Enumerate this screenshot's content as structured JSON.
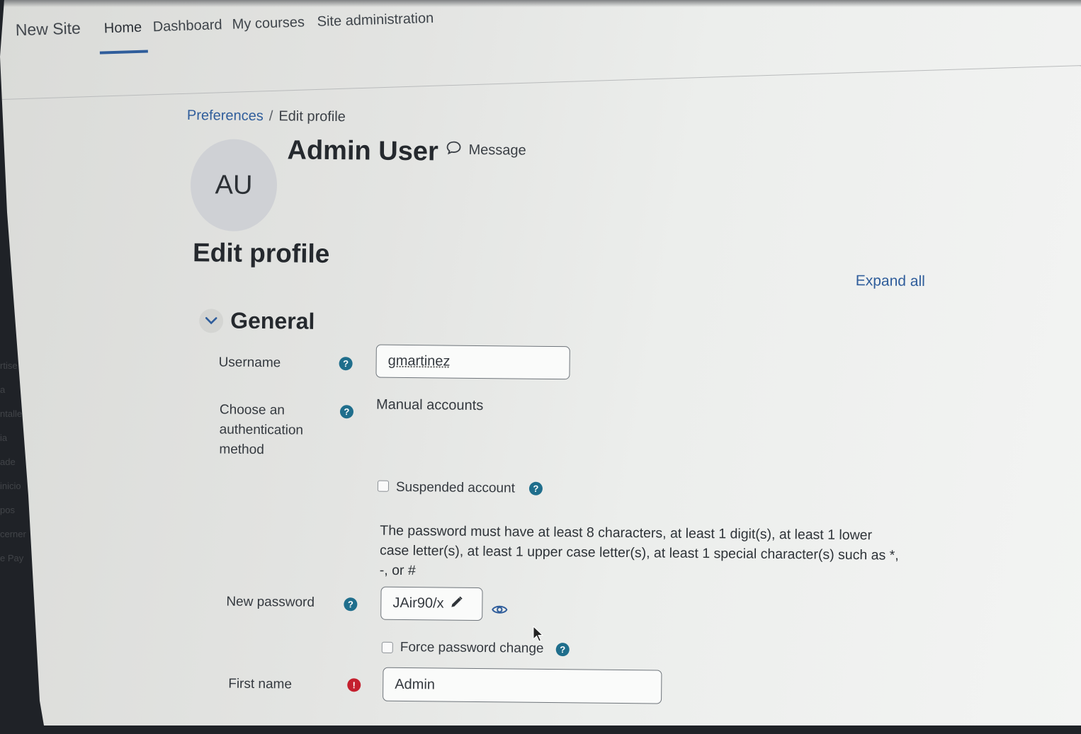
{
  "header": {
    "site_name": "New Site",
    "nav": [
      {
        "label": "Home",
        "active": true
      },
      {
        "label": "Dashboard",
        "active": false
      },
      {
        "label": "My courses",
        "active": false
      },
      {
        "label": "Site administration",
        "active": false
      }
    ]
  },
  "breadcrumb": {
    "parent": "Preferences",
    "separator": "/",
    "current": "Edit profile"
  },
  "profile": {
    "initials": "AU",
    "name": "Admin User",
    "message_label": "Message"
  },
  "page": {
    "title": "Edit profile",
    "expand_all": "Expand all"
  },
  "general": {
    "title": "General",
    "username_label": "Username",
    "username_value": "gmartinez",
    "auth_label_lines": [
      "Choose an",
      "authentication",
      "method"
    ],
    "auth_value": "Manual accounts",
    "suspended_label": "Suspended account",
    "suspended_checked": false,
    "password_rule_lines": [
      "The password must have at least 8 characters, at least 1 digit(s), at least 1 lower",
      "case letter(s), at least 1 upper case letter(s), at least 1 special character(s) such as *,",
      "-, or #"
    ],
    "new_password_label": "New password",
    "new_password_value": "JAir90/x",
    "force_change_label": "Force password change",
    "force_change_checked": false,
    "first_name_label": "First name",
    "first_name_value": "Admin"
  },
  "colors": {
    "link": "#2f5d9b",
    "help_icon": "#1f6e8c",
    "required_icon": "#c4202e"
  },
  "icons": [
    "message-icon",
    "chevron-down-icon",
    "help-icon",
    "required-icon",
    "pencil-icon",
    "eye-icon",
    "cursor-icon"
  ],
  "side_ghost_text": [
    "rtise",
    "a",
    "ntalle",
    "ia",
    "ade",
    "inicio",
    "pos",
    "cerner",
    "e Pay"
  ]
}
